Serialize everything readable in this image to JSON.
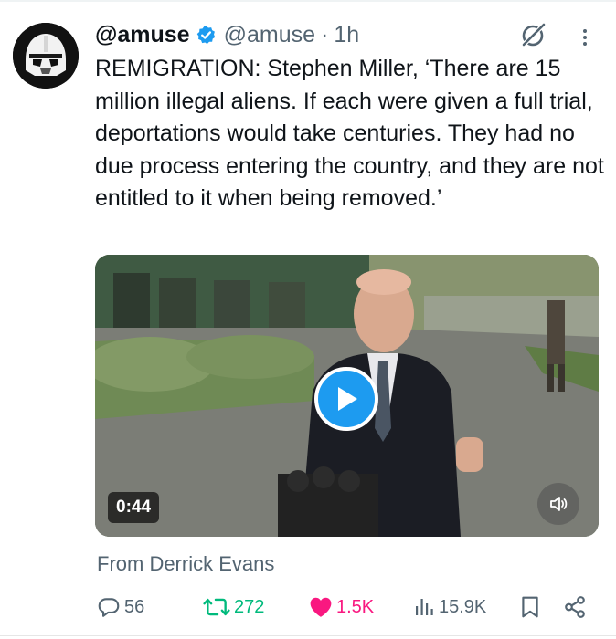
{
  "tweet": {
    "display_name": "@amuse",
    "handle": "@amuse",
    "separator": "·",
    "time": "1h",
    "text": "REMIGRATION: Stephen Miller, ‘There are 15 million illegal aliens. If each were given a full trial, deportations would take centuries. They had no due process entering the country, and they are not entitled to it when being removed.’"
  },
  "media": {
    "duration": "0:44"
  },
  "attribution": "From Derrick Evans",
  "actions": {
    "replies": "56",
    "reposts": "272",
    "likes": "1.5K",
    "views": "15.9K"
  },
  "icons": {
    "verified": "verified-badge-icon",
    "grok": "grok-icon",
    "more": "more-options-icon",
    "play": "play-icon",
    "mute": "volume-muted-icon",
    "reply": "reply-icon",
    "repost": "repost-icon",
    "like": "heart-filled-icon",
    "views": "views-chart-icon",
    "bookmark": "bookmark-icon",
    "share": "share-icon"
  },
  "colors": {
    "accent": "#1d9bf0",
    "repost": "#00ba7c",
    "like": "#f91880",
    "secondary_text": "#536471"
  }
}
